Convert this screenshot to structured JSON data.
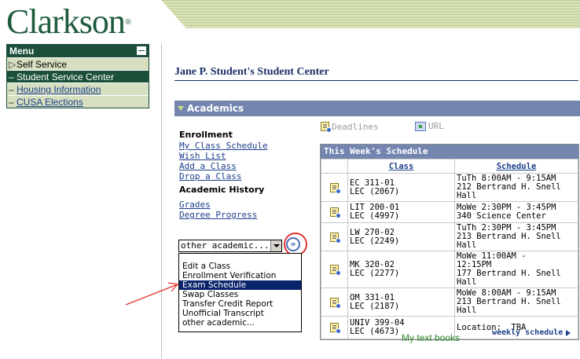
{
  "logo": {
    "text": "Clarkson",
    "mark": "®"
  },
  "menu": {
    "title": "Menu",
    "items": [
      {
        "marker": "▷",
        "label": "Self Service",
        "link": false,
        "active": false
      },
      {
        "marker": "–",
        "label": "Student Service Center",
        "link": false,
        "active": true
      },
      {
        "marker": "–",
        "label": "Housing Information",
        "link": true,
        "active": false
      },
      {
        "marker": "–",
        "label": "CUSA Elections",
        "link": true,
        "active": false
      }
    ]
  },
  "page_title": "Jane P. Student's Student Center",
  "academics": {
    "header": "Academics",
    "enrollment_heading": "Enrollment",
    "enrollment_links": [
      "My Class Schedule",
      "Wish List",
      "Add a Class",
      "Drop a Class"
    ],
    "history_heading": "Academic History",
    "history_links": [
      "Grades",
      "Degree Progress"
    ],
    "dropdown_value": "other academic...",
    "go_label": "»",
    "dropdown_options": [
      {
        "label": "Edit a Class",
        "selected": false
      },
      {
        "label": "Enrollment Verification",
        "selected": false
      },
      {
        "label": "Exam Schedule",
        "selected": true
      },
      {
        "label": "Swap Classes",
        "selected": false
      },
      {
        "label": "Transfer Credit Report",
        "selected": false
      },
      {
        "label": "Unofficial Transcript",
        "selected": false
      },
      {
        "label": "other academic...",
        "selected": false
      }
    ]
  },
  "deadlines_label": "Deadlines",
  "url_label": "URL",
  "schedule": {
    "title": "This Week's Schedule",
    "col_class": "Class",
    "col_schedule": "Schedule",
    "rows": [
      {
        "class_1": "EC 311-01",
        "class_2": "LEC (2067)",
        "sched_1": "TuTh 8:00AM - 9:15AM",
        "sched_2": "212 Bertrand H. Snell Hall",
        "sched_3": ""
      },
      {
        "class_1": "LIT 200-01",
        "class_2": "LEC (4997)",
        "sched_1": "MoWe 2:30PM - 3:45PM",
        "sched_2": "340 Science Center",
        "sched_3": ""
      },
      {
        "class_1": "LW 270-02",
        "class_2": "LEC (2249)",
        "sched_1": "TuTh 2:30PM - 3:45PM",
        "sched_2": "213 Bertrand H. Snell Hall",
        "sched_3": ""
      },
      {
        "class_1": "MK 320-02",
        "class_2": "LEC (2277)",
        "sched_1": "MoWe 11:00AM -",
        "sched_2": "12:15PM",
        "sched_3": "177 Bertrand H. Snell Hall"
      },
      {
        "class_1": "OM 331-01",
        "class_2": "LEC (2187)",
        "sched_1": "MoWe 8:00AM - 9:15AM",
        "sched_2": "213 Bertrand H. Snell Hall",
        "sched_3": ""
      },
      {
        "class_1": "UNIV 399-04",
        "class_2": "LEC (4673)",
        "sched_1": "Location:  TBA",
        "sched_2": "",
        "sched_3": ""
      }
    ]
  },
  "my_textbooks": "My text books",
  "weekly_schedule": "weekly schedule",
  "colors": {
    "brand_green": "#1b4f3a",
    "section_bar": "#7485b0",
    "annotation_red": "#e53030"
  }
}
